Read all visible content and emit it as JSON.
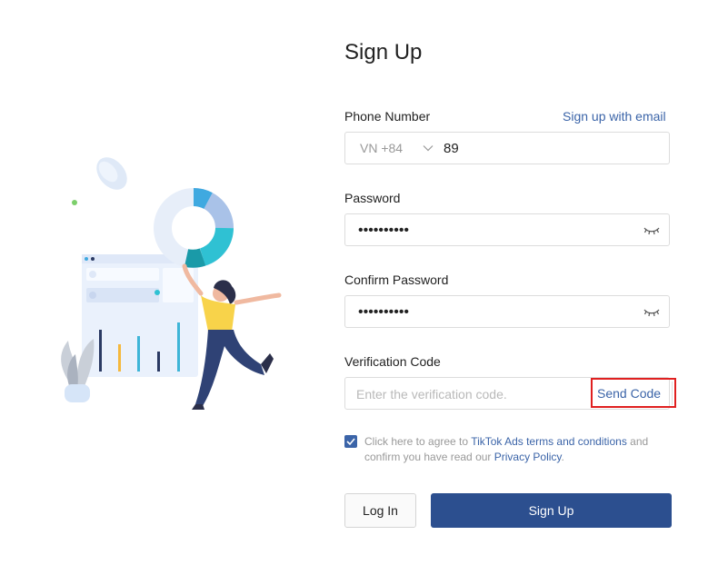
{
  "form": {
    "title": "Sign Up",
    "phone": {
      "label": "Phone Number",
      "alt_link": "Sign up with email",
      "country_code": "VN +84",
      "value": "89"
    },
    "password": {
      "label": "Password",
      "value": "••••••••••"
    },
    "confirm_password": {
      "label": "Confirm Password",
      "value": "••••••••••"
    },
    "verification": {
      "label": "Verification Code",
      "placeholder": "Enter the verification code.",
      "send_label": "Send Code"
    },
    "agreement": {
      "checked": true,
      "text_1": "Click here to agree to ",
      "terms_link": "TikTok Ads terms and conditions",
      "text_2": " and confirm you have read our ",
      "privacy_link": "Privacy Policy",
      "text_3": "."
    },
    "login_button": "Log In",
    "signup_button": "Sign Up"
  },
  "colors": {
    "accent": "#2c4f8f",
    "link": "#3b64a8",
    "highlight": "#e02020"
  }
}
